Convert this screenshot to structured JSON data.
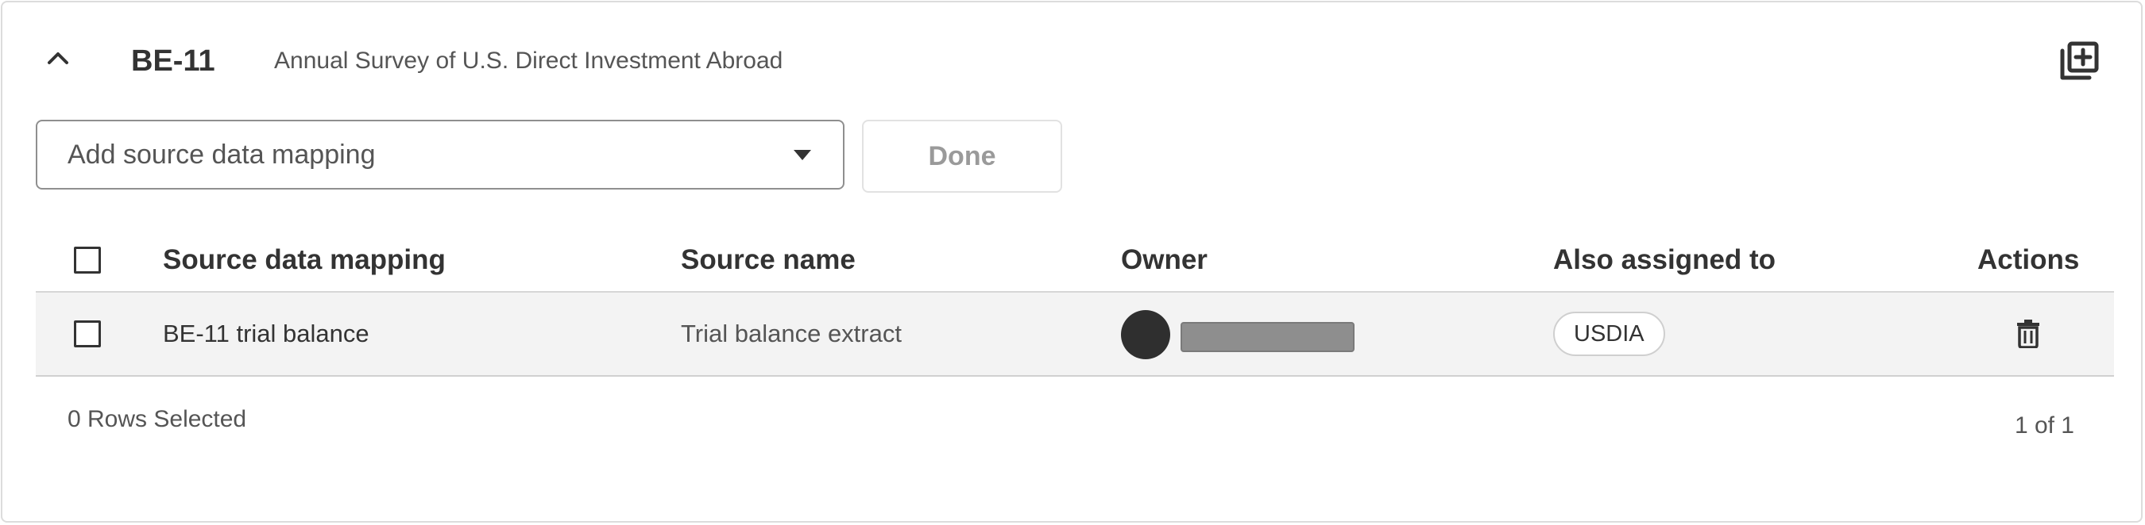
{
  "header": {
    "form_code": "BE-11",
    "form_description": "Annual Survey of U.S. Direct Investment Abroad"
  },
  "icons": {
    "collapse": "chevron-up-icon",
    "add": "add-to-library-icon",
    "dropdown": "caret-down-icon",
    "delete": "trash-icon"
  },
  "controls": {
    "dropdown_placeholder": "Add source data mapping",
    "done_label": "Done"
  },
  "table": {
    "columns": [
      "Source data mapping",
      "Source name",
      "Owner",
      "Also assigned to",
      "Actions"
    ],
    "rows": [
      {
        "source_data_mapping": "BE-11 trial balance",
        "source_name": "Trial balance extract",
        "also_assigned_to": "USDIA"
      }
    ]
  },
  "footer": {
    "rows_selected": "0 Rows Selected",
    "pagination": "1 of 1"
  },
  "colors": {
    "text": "#333333",
    "muted": "#555555",
    "row_bg": "#f3f3f3",
    "border": "#dcdcdc",
    "avatar": "#2f2f2f",
    "redacted": "#8e8e8e"
  }
}
